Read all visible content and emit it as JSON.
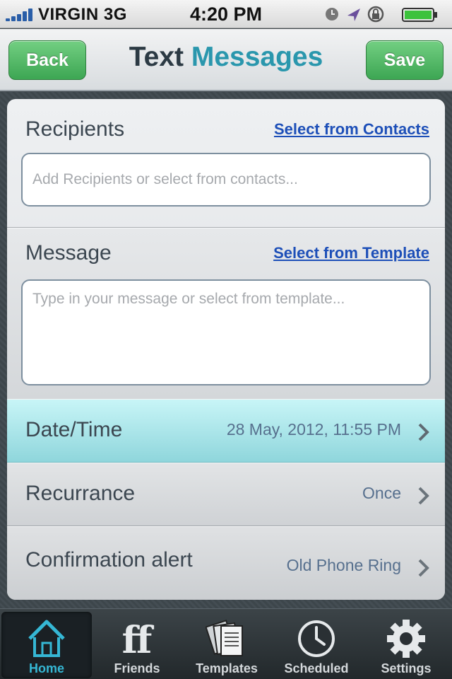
{
  "status_bar": {
    "carrier": "VIRGIN",
    "network": "3G",
    "time": "4:20 PM"
  },
  "nav": {
    "back_label": "Back",
    "title_part1": "Text",
    "title_part2": "Messages",
    "save_label": "Save"
  },
  "recipients": {
    "label": "Recipients",
    "link": "Select from Contacts",
    "placeholder": "Add Recipients or select from contacts..."
  },
  "message": {
    "label": "Message",
    "link": "Select from Template",
    "placeholder": "Type in your message or select from template..."
  },
  "rows": [
    {
      "label": "Date/Time",
      "value": "28 May, 2012, 11:55 PM"
    },
    {
      "label": "Recurrance",
      "value": "Once"
    },
    {
      "label": "Confirmation alert",
      "value": "Old Phone Ring"
    }
  ],
  "tabs": [
    {
      "label": "Home",
      "icon": "home-icon",
      "active": true
    },
    {
      "label": "Friends",
      "icon": "friends-icon"
    },
    {
      "label": "Templates",
      "icon": "templates-icon"
    },
    {
      "label": "Scheduled",
      "icon": "clock-icon"
    },
    {
      "label": "Settings",
      "icon": "gear-icon"
    }
  ],
  "colors": {
    "accent": "#2a97ad",
    "button_green": "#3da653",
    "active_tab": "#35b7d4",
    "link": "#1d4fb8"
  }
}
